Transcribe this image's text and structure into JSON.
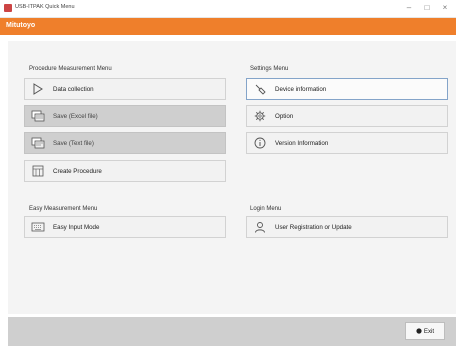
{
  "window": {
    "title": "USB-ITPAK Quick Menu",
    "minimize": "–",
    "maximize": "□",
    "close": "×"
  },
  "brand": "Mitutoyo",
  "procedure_menu": {
    "title": "Procedure Measurement Menu",
    "items": [
      {
        "label": "Data collection",
        "icon": "play-outline-icon",
        "state": "enabled"
      },
      {
        "label": "Save (Excel file)",
        "icon": "save-excel-icon",
        "state": "disabled"
      },
      {
        "label": "Save (Text file)",
        "icon": "save-text-icon",
        "state": "disabled"
      },
      {
        "label": "Create Procedure",
        "icon": "procedure-grid-icon",
        "state": "enabled"
      }
    ]
  },
  "settings_menu": {
    "title": "Settings Menu",
    "items": [
      {
        "label": "Device information",
        "icon": "device-probe-icon",
        "state": "selected"
      },
      {
        "label": "Option",
        "icon": "gear-icon",
        "state": "enabled"
      },
      {
        "label": "Version Information",
        "icon": "info-icon",
        "state": "enabled"
      }
    ]
  },
  "easy_menu": {
    "title": "Easy Measurement Menu",
    "items": [
      {
        "label": "Easy Input Mode",
        "icon": "keyboard-icon",
        "state": "enabled"
      }
    ]
  },
  "login_menu": {
    "title": "Login Menu",
    "items": [
      {
        "label": "User Registration or Update",
        "icon": "user-icon",
        "state": "enabled"
      }
    ]
  },
  "footer": {
    "exit_label": "Exit",
    "exit_icon": "exit-dot-icon"
  },
  "colors": {
    "brand": "#ef7f2b",
    "disabled_bg": "#cfcfcf",
    "selected_border": "#84a4c9"
  }
}
